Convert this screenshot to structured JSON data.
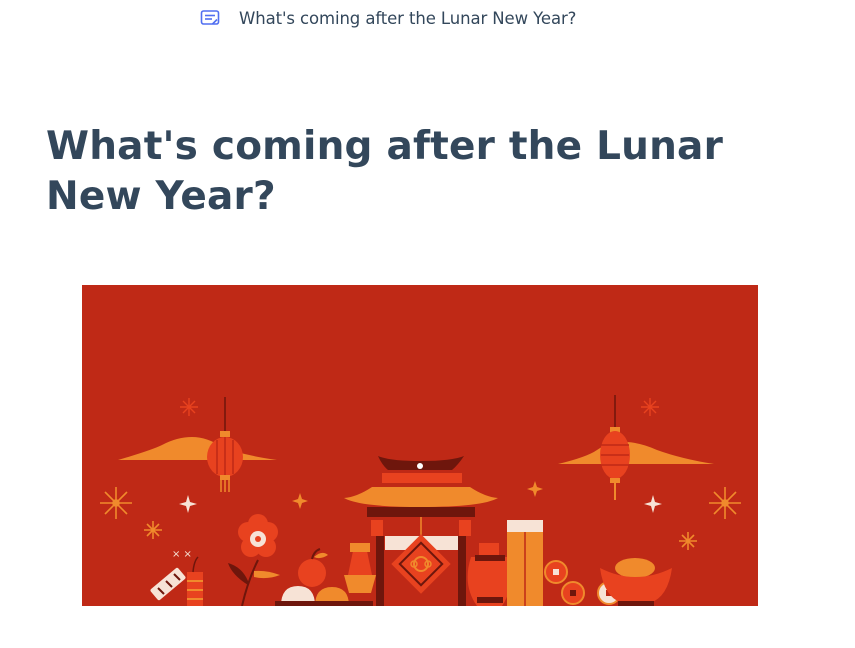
{
  "breadcrumb": {
    "icon": "post-icon",
    "text": "What's coming after the Lunar New Year?"
  },
  "article": {
    "title": "What's coming after the Lunar New Year?",
    "hero_image": "lunar-new-year-illustration"
  },
  "colors": {
    "title_text": "#33475b",
    "icon_accent": "#516ff0",
    "hero_background": "#bf2916",
    "hero_orange": "#f08a2c",
    "hero_red": "#e8421f",
    "hero_dark": "#6e160c"
  }
}
